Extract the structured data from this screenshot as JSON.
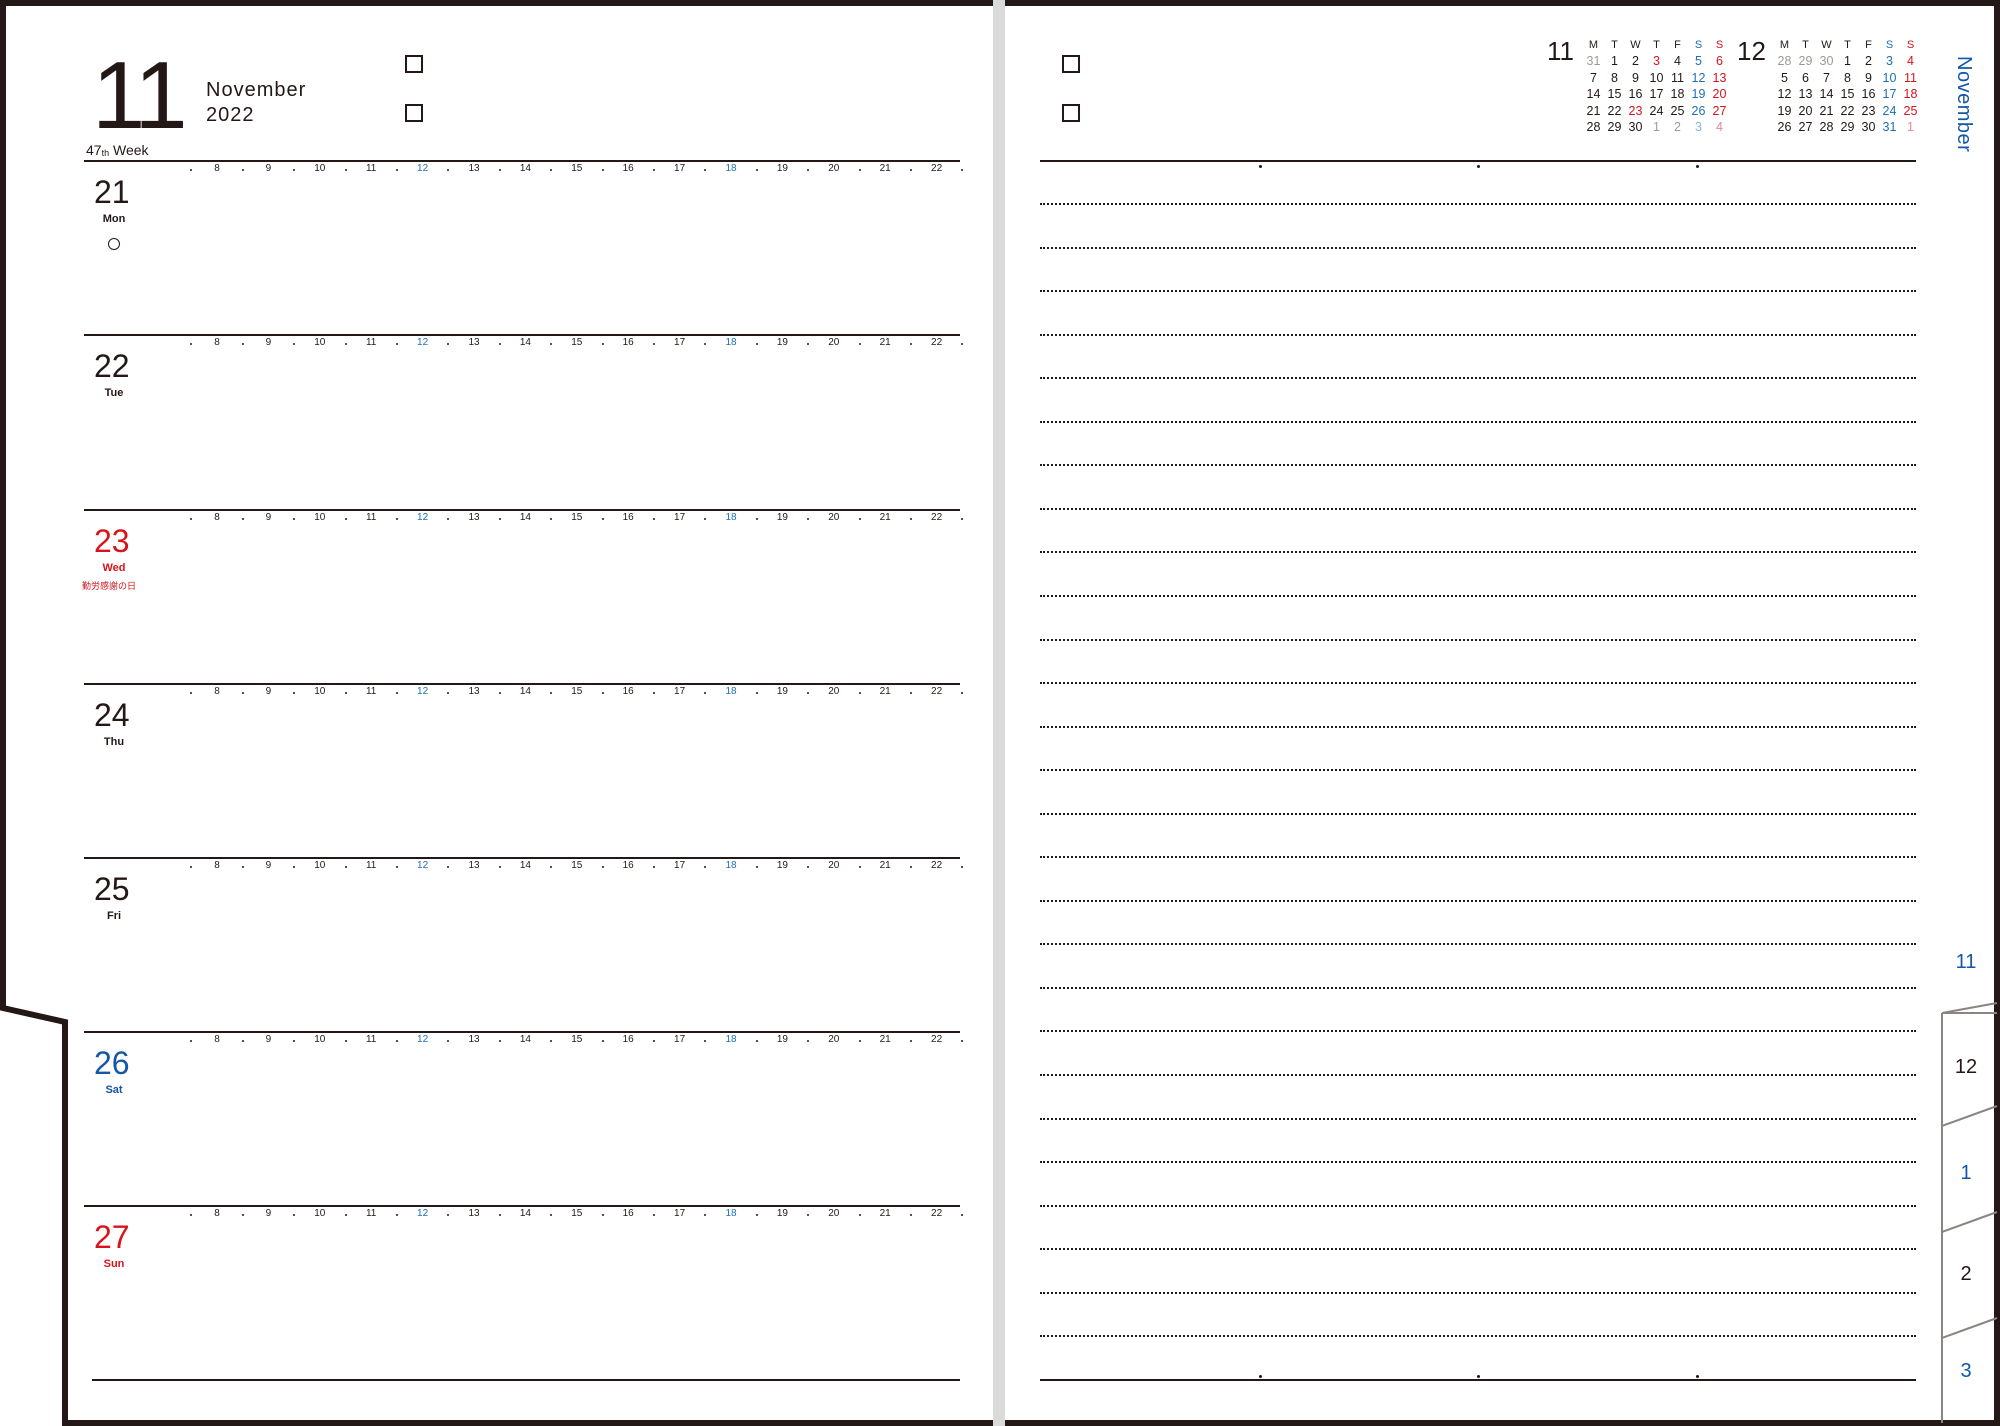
{
  "left_page": {
    "month_number": "11",
    "month_name": "November",
    "year": "2022",
    "week_number": "47",
    "week_suffix": "th",
    "week_word": "Week",
    "hours": [
      "8",
      "9",
      "10",
      "11",
      "12",
      "13",
      "14",
      "15",
      "16",
      "17",
      "18",
      "19",
      "20",
      "21",
      "22"
    ],
    "highlight_hours": [
      "12",
      "18"
    ],
    "days": [
      {
        "date": "21",
        "weekday": "Mon",
        "color": "black",
        "holiday": "",
        "moon_phase": "full-moon-icon"
      },
      {
        "date": "22",
        "weekday": "Tue",
        "color": "black",
        "holiday": ""
      },
      {
        "date": "23",
        "weekday": "Wed",
        "color": "red",
        "holiday": "勤労感謝の日"
      },
      {
        "date": "24",
        "weekday": "Thu",
        "color": "black",
        "holiday": ""
      },
      {
        "date": "25",
        "weekday": "Fri",
        "color": "black",
        "holiday": ""
      },
      {
        "date": "26",
        "weekday": "Sat",
        "color": "blue",
        "holiday": ""
      },
      {
        "date": "27",
        "weekday": "Sun",
        "color": "red",
        "holiday": ""
      }
    ]
  },
  "right_page": {
    "mini_calendars": [
      {
        "month": "11",
        "weekday_headers": [
          "M",
          "T",
          "W",
          "T",
          "F",
          "S",
          "S"
        ],
        "weeks": [
          [
            "31",
            "1",
            "2",
            "3",
            "4",
            "5",
            "6"
          ],
          [
            "7",
            "8",
            "9",
            "10",
            "11",
            "12",
            "13"
          ],
          [
            "14",
            "15",
            "16",
            "17",
            "18",
            "19",
            "20"
          ],
          [
            "21",
            "22",
            "23",
            "24",
            "25",
            "26",
            "27"
          ],
          [
            "28",
            "29",
            "30",
            "1",
            "2",
            "3",
            "4"
          ]
        ]
      },
      {
        "month": "12",
        "weekday_headers": [
          "M",
          "T",
          "W",
          "T",
          "F",
          "S",
          "S"
        ],
        "weeks": [
          [
            "28",
            "29",
            "30",
            "1",
            "2",
            "3",
            "4"
          ],
          [
            "5",
            "6",
            "7",
            "8",
            "9",
            "10",
            "11"
          ],
          [
            "12",
            "13",
            "14",
            "15",
            "16",
            "17",
            "18"
          ],
          [
            "19",
            "20",
            "21",
            "22",
            "23",
            "24",
            "25"
          ],
          [
            "26",
            "27",
            "28",
            "29",
            "30",
            "31",
            "1"
          ]
        ]
      }
    ],
    "side_month_label": "November",
    "tabs": [
      "11",
      "12",
      "1",
      "2",
      "3"
    ]
  },
  "colors": {
    "ink": "#231815",
    "sunday_holiday_red": "#d7141c",
    "saturday_blue": "#1357a6",
    "accent_blue": "#1d6fb8",
    "spine_grey": "#dadada"
  }
}
